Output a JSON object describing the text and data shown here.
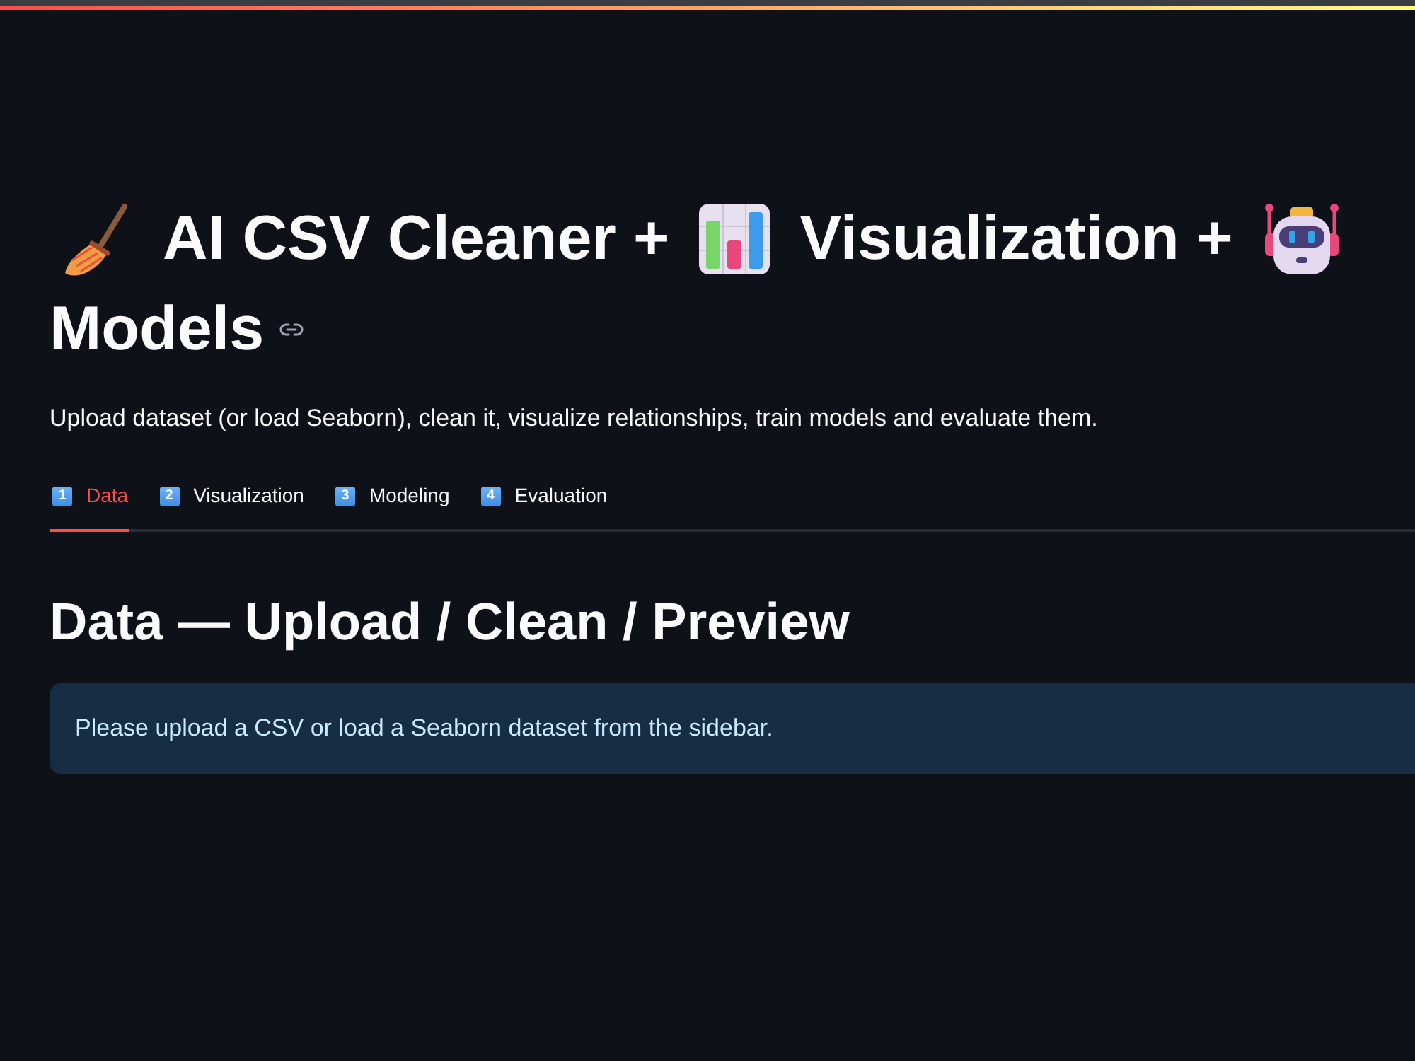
{
  "title": {
    "segments": [
      "AI CSV Cleaner +",
      "Visualization +",
      "Models"
    ]
  },
  "caption": "Upload dataset (or load Seaborn), clean it, visualize relationships, train models and evaluate them.",
  "tabs": [
    {
      "number": "1",
      "label": "Data",
      "selected": true
    },
    {
      "number": "2",
      "label": "Visualization",
      "selected": false
    },
    {
      "number": "3",
      "label": "Modeling",
      "selected": false
    },
    {
      "number": "4",
      "label": "Evaluation",
      "selected": false
    }
  ],
  "section": {
    "heading": "Data — Upload / Clean / Preview",
    "info": "Please upload a CSV or load a Seaborn dataset from the sidebar."
  }
}
